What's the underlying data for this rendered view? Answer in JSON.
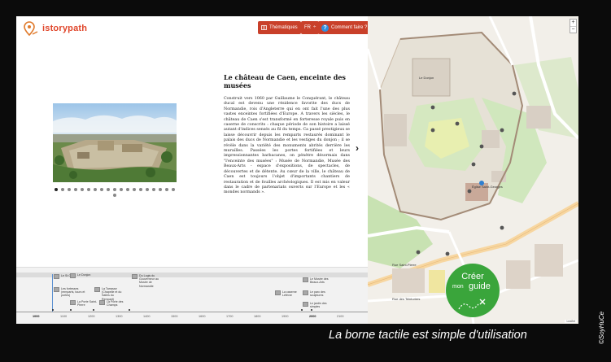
{
  "header": {
    "logo_text": "istorypath",
    "btn_thematiques": "Thématiques",
    "btn_lang": "FR",
    "btn_lang_caret": "÷",
    "btn_help_icon": "?",
    "btn_help": "Comment faire ?"
  },
  "article": {
    "title": "Le château de Caen, enceinte des musées",
    "body": "Construit vers 1060 par Guillaume le Conquérant, le château ducal est devenu une résidence favorite des ducs de Normandie, rois d'Angleterre qui en ont fait l'une des plus vastes enceintes fortifiées d'Europe. A travers les siècles, le château de Caen s'est transformé en forteresse royale puis en caserne de conscrits : chaque période de son histoire a laissé autant d'indices sensés au fil du temps. Ca passé prestigieux se laisse découvrir depuis les remparts restaurés dominant le palais des ducs de Normandie et les vestiges du donjon ; il se révèle dans la variété des monuments abrités derrière les murailles. Passées les portes fortifiées et leurs impressionnantes barbacanes, on pénètre désormais dans \"l'enceinte des musées\" : Musée de Normandie, Musée des Beaux-Arts - espace d'expositions, de spectacles, de découvertes et de détente. Au cœur de la ville, le château de Caen est toujours l'objet d'importants chantiers de restauration et de fouilles archéologiques. Il est mis en valeur dans le cadre de partenariats ouverts sur l'Europe et les « mondes normands »."
  },
  "carousel": {
    "dot_count": 20,
    "active_index": 0
  },
  "timeline": {
    "events": [
      {
        "label": "Le St Gabe"
      },
      {
        "label": "Le Donjon"
      },
      {
        "label": "Du Logis du Gouverneur au Musée de Normandie"
      },
      {
        "label": "Les fortesses (remparts, tours et portes)"
      },
      {
        "label": "La Tarrasse (Chapelle et du Salles du Rempart)"
      },
      {
        "label": "La Porte Saint-Pierre"
      },
      {
        "label": "La Porte des Champs"
      },
      {
        "label": "La caserne Lefèvre"
      },
      {
        "label": "Le Musée des Beaux-Arts"
      },
      {
        "label": "Le parc des sculptures"
      },
      {
        "label": "Le jardin des simples"
      }
    ],
    "years": [
      "1000",
      "1100",
      "1200",
      "1300",
      "1400",
      "1500",
      "1600",
      "1700",
      "1800",
      "1900",
      "2000",
      "2100"
    ],
    "bold_years": [
      "1000",
      "2000"
    ]
  },
  "map": {
    "labels": [
      "Le Donjon",
      "Église Saint-Georges",
      "Rue Saint-Pierre",
      "Rue des Teinturiers"
    ],
    "zoom_in": "+",
    "zoom_out": "−",
    "attribution": "Leaflet",
    "creer_1": "Créer",
    "creer_2": "mon",
    "creer_3": "guide"
  },
  "caption": "La borne tactile est simple d'utilisation",
  "credit": "©SoyHuCe"
}
